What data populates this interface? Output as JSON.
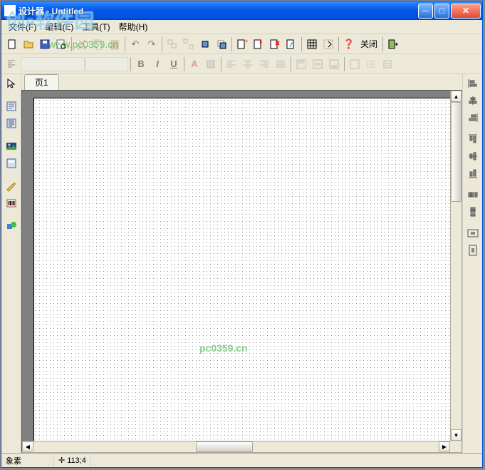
{
  "title": "设计器 - Untitled",
  "menu": {
    "file": "文件(F)",
    "edit": "编辑(E)",
    "tools": "工具(T)",
    "help": "帮助(H)"
  },
  "toolbar1": {
    "close_label": "关闭"
  },
  "toolbar2": {
    "bold": "B",
    "italic": "I",
    "underline": "U",
    "font_a": "A"
  },
  "tabs": {
    "page1": "页1"
  },
  "status": {
    "element": "象素",
    "coords": "113;4"
  },
  "watermarks": {
    "logo": "创e软件园",
    "url1": "www.pc0359.cn",
    "url2": "pc0359.cn"
  }
}
